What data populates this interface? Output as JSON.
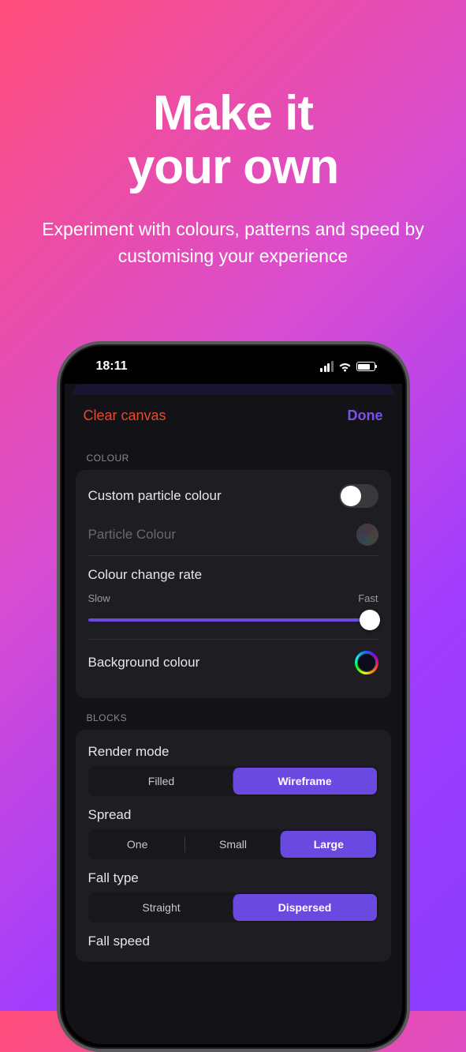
{
  "hero": {
    "title_line1": "Make it",
    "title_line2": "your own",
    "subtitle": "Experiment with colours, patterns and speed by customising your experience"
  },
  "statusbar": {
    "time": "18:11"
  },
  "navbar": {
    "left": "Clear canvas",
    "right": "Done"
  },
  "sections": {
    "colour": {
      "header": "COLOUR",
      "custom_particle": "Custom particle colour",
      "particle_colour": "Particle Colour",
      "change_rate": "Colour change rate",
      "slow": "Slow",
      "fast": "Fast",
      "background": "Background colour"
    },
    "blocks": {
      "header": "BLOCKS",
      "render_mode": {
        "label": "Render mode",
        "options": [
          "Filled",
          "Wireframe"
        ],
        "selected": "Wireframe"
      },
      "spread": {
        "label": "Spread",
        "options": [
          "One",
          "Small",
          "Large"
        ],
        "selected": "Large"
      },
      "fall_type": {
        "label": "Fall type",
        "options": [
          "Straight",
          "Dispersed"
        ],
        "selected": "Dispersed"
      },
      "fall_speed": {
        "label": "Fall speed"
      }
    }
  }
}
